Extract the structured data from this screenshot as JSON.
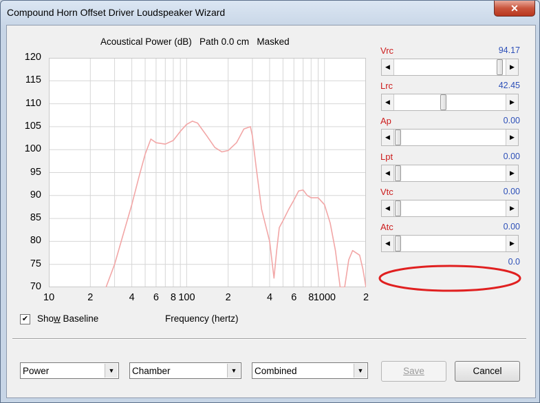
{
  "window": {
    "title": "Compound Horn Offset Driver Loudspeaker Wizard",
    "close_glyph": "✕"
  },
  "chart": {
    "title": "Acoustical Power (dB)   Path 0.0 cm   Masked",
    "xaxis_label": "Frequency (hertz)",
    "y_ticks": [
      "120",
      "115",
      "110",
      "105",
      "100",
      "95",
      "90",
      "85",
      "80",
      "75",
      "70"
    ],
    "x_ticks": [
      "10",
      "2",
      "4",
      "6",
      "8",
      "100",
      "2",
      "4",
      "6",
      "8",
      "1000",
      "2"
    ]
  },
  "chart_data": {
    "type": "line",
    "title": "Acoustical Power (dB)   Path 0.0 cm   Masked",
    "xlabel": "Frequency (hertz)",
    "ylabel": "",
    "x_scale": "log",
    "xlim": [
      10,
      2000
    ],
    "ylim": [
      70,
      120
    ],
    "grid": true,
    "series": [
      {
        "color": "#f2a6a6",
        "x": [
          26,
          30,
          35,
          40,
          45,
          50,
          55,
          60,
          70,
          80,
          90,
          100,
          110,
          120,
          140,
          160,
          180,
          200,
          230,
          260,
          290,
          300,
          320,
          350,
          400,
          430,
          450,
          470,
          500,
          550,
          600,
          650,
          700,
          750,
          800,
          900,
          1000,
          1100,
          1200,
          1300,
          1400,
          1500,
          1600,
          1800,
          1900,
          2000
        ],
        "y": [
          70,
          75,
          82,
          88,
          94,
          99,
          102.3,
          101.5,
          101.2,
          102,
          104,
          105.5,
          106.2,
          105.8,
          103,
          100.5,
          99.5,
          99.8,
          101.5,
          104.5,
          105,
          103,
          96,
          87,
          80,
          72,
          78,
          83,
          84.5,
          87,
          89,
          91,
          91.2,
          90,
          89.5,
          89.5,
          88,
          84,
          78,
          70,
          70,
          76,
          78,
          77,
          74,
          70
        ]
      }
    ]
  },
  "sliders": [
    {
      "name": "Vrc",
      "value": "94.17",
      "pos": 0.97
    },
    {
      "name": "Lrc",
      "value": "42.45",
      "pos": 0.43
    },
    {
      "name": "Ap",
      "value": "0.00",
      "pos": 0.0
    },
    {
      "name": "Lpt",
      "value": "0.00",
      "pos": 0.0
    },
    {
      "name": "Vtc",
      "value": "0.00",
      "pos": 0.0
    },
    {
      "name": "Atc",
      "value": "0.00",
      "pos": 0.0
    }
  ],
  "extra_value": "0.0",
  "annotation": {
    "color": "#e02020"
  },
  "show_baseline": {
    "label_pre": "Sho",
    "label_ul": "w",
    "label_post": " Baseline",
    "checked": true,
    "check_glyph": "✔"
  },
  "dropdowns": [
    {
      "value": "Power"
    },
    {
      "value": "Chamber"
    },
    {
      "value": "Combined"
    }
  ],
  "buttons": {
    "save": "Save",
    "cancel": "Cancel"
  },
  "arrows": {
    "left": "◀",
    "right": "▶",
    "down": "▼"
  }
}
